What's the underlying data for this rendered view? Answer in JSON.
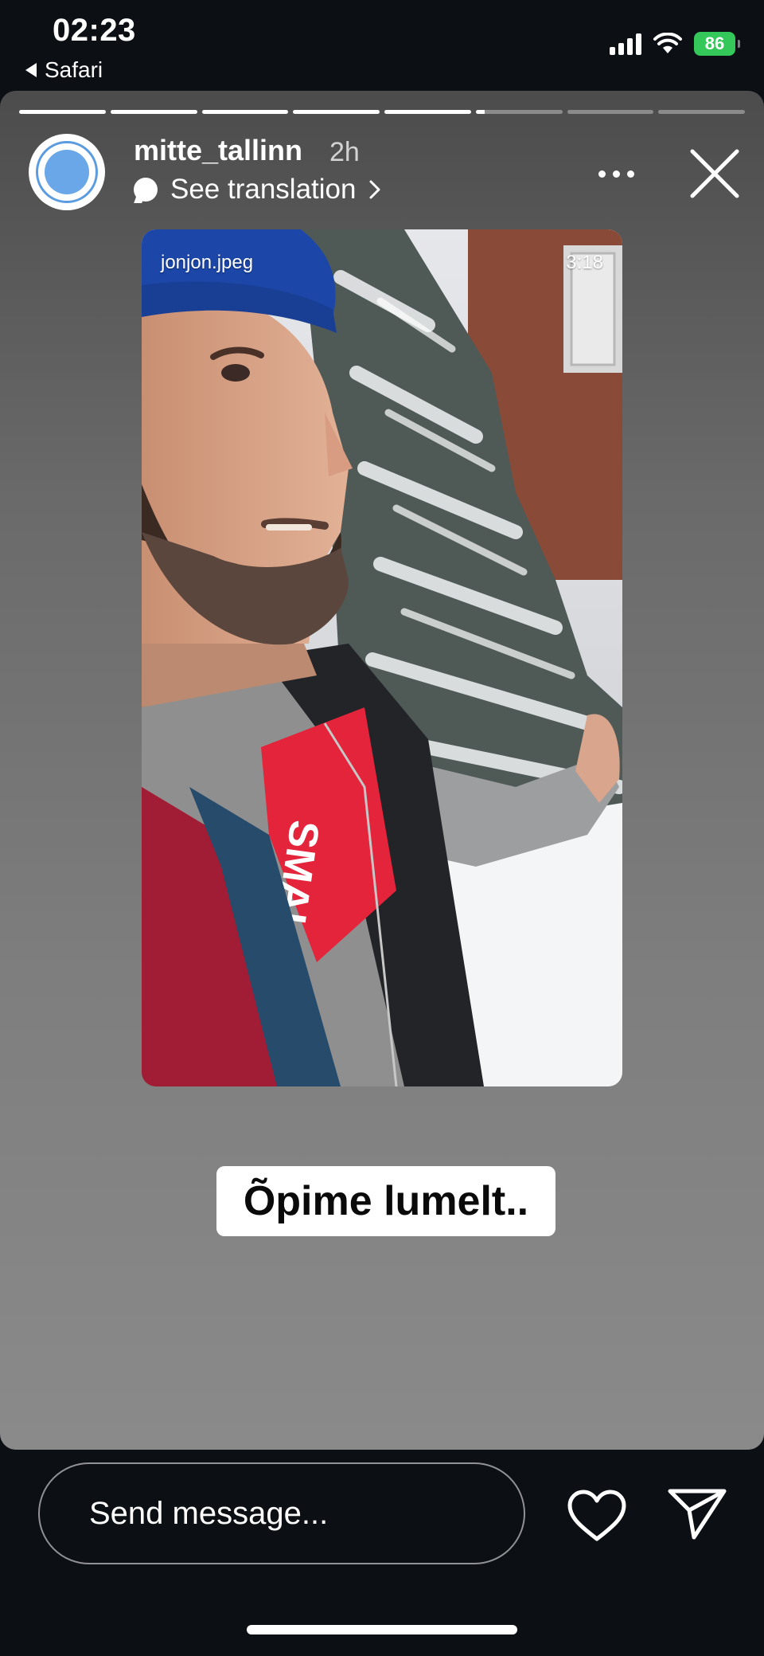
{
  "status_bar": {
    "time": "02:23",
    "back_app": "Safari",
    "battery": "86"
  },
  "story": {
    "segments_progress": [
      1,
      1,
      1,
      1,
      1,
      0.1,
      0,
      0
    ],
    "username": "mitte_tallinn",
    "age": "2h",
    "translate_label": "See translation",
    "video": {
      "source_label": "jonjon.jpeg",
      "duration": "3:18",
      "shirt_text": "SMAL VOITA"
    },
    "caption": "Õpime lumelt.."
  },
  "bottom_bar": {
    "message_placeholder": "Send message..."
  },
  "colors": {
    "battery": "#34c759",
    "avatar_ring": "#5b9be0"
  },
  "icons": [
    "signal-icon",
    "wifi-icon",
    "battery-icon",
    "more-icon",
    "close-icon",
    "heart-icon",
    "send-icon",
    "translate-bubble-icon"
  ]
}
